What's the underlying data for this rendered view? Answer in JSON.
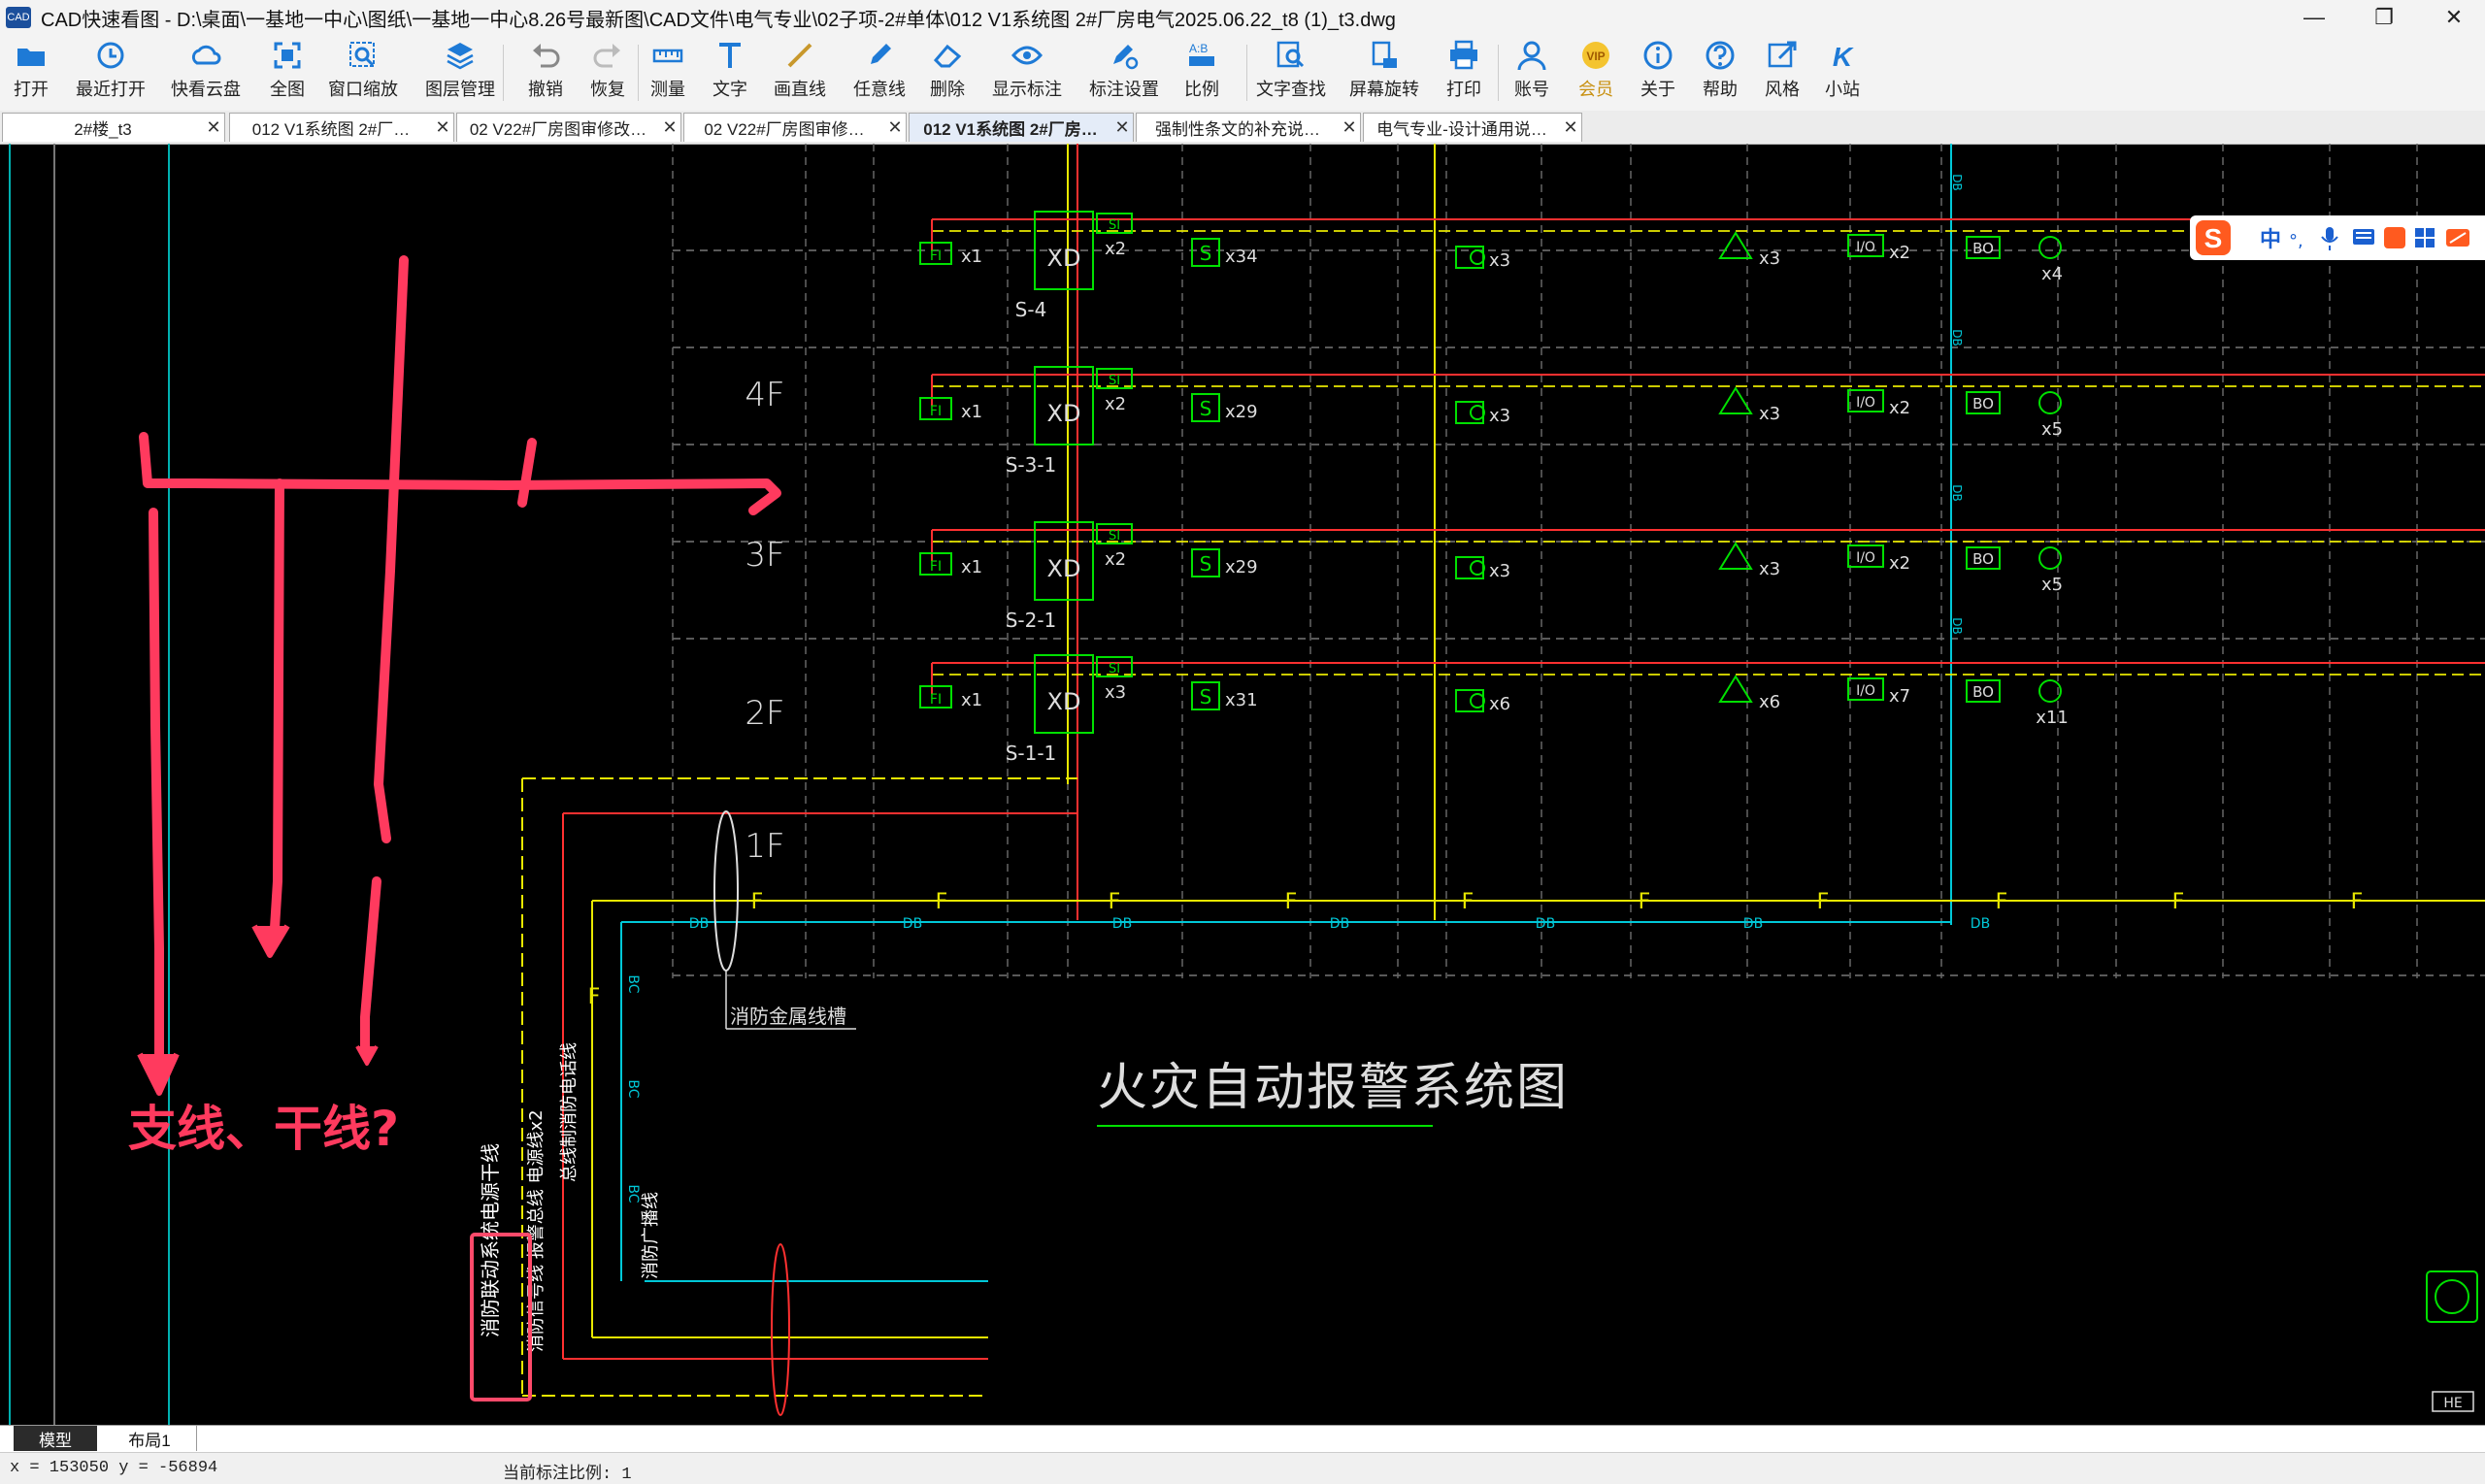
{
  "window": {
    "title": "CAD快速看图 - D:\\桌面\\一基地一中心\\图纸\\一基地一中心8.26号最新图\\CAD文件\\电气专业\\02子项-2#单体\\012 V1系统图 2#厂房电气2025.06.22_t8 (1)_t3.dwg",
    "app_icon_text": "CAD"
  },
  "toolbar": [
    {
      "label": "打开",
      "icon": "folder-icon"
    },
    {
      "label": "最近打开",
      "icon": "clock-icon"
    },
    {
      "label": "快看云盘",
      "icon": "cloud-icon"
    },
    {
      "label": "全图",
      "icon": "fullview-icon"
    },
    {
      "label": "窗口缩放",
      "icon": "zoom-window-icon"
    },
    {
      "label": "图层管理",
      "icon": "layers-icon"
    },
    {
      "label": "撤销",
      "icon": "undo-icon"
    },
    {
      "label": "恢复",
      "icon": "redo-icon"
    },
    {
      "label": "测量",
      "icon": "ruler-icon"
    },
    {
      "label": "文字",
      "icon": "text-icon"
    },
    {
      "label": "画直线",
      "icon": "line-icon"
    },
    {
      "label": "任意线",
      "icon": "pen-icon"
    },
    {
      "label": "删除",
      "icon": "eraser-icon"
    },
    {
      "label": "显示标注",
      "icon": "eye-icon"
    },
    {
      "label": "标注设置",
      "icon": "annotation-settings-icon"
    },
    {
      "label": "比例",
      "icon": "scale-icon"
    },
    {
      "label": "文字查找",
      "icon": "text-search-icon"
    },
    {
      "label": "屏幕旋转",
      "icon": "rotate-icon"
    },
    {
      "label": "打印",
      "icon": "printer-icon"
    },
    {
      "label": "账号",
      "icon": "user-icon"
    },
    {
      "label": "会员",
      "icon": "vip-icon",
      "badge": "VIP"
    },
    {
      "label": "关于",
      "icon": "info-icon"
    },
    {
      "label": "帮助",
      "icon": "help-icon"
    },
    {
      "label": "风格",
      "icon": "style-icon"
    },
    {
      "label": "小站",
      "icon": "station-icon"
    }
  ],
  "tabs": [
    {
      "label": "2#楼_t3",
      "active": false
    },
    {
      "label": "012 V1系统图 2#厂…",
      "active": false
    },
    {
      "label": "02 V22#厂房图审修改…",
      "active": false
    },
    {
      "label": "02 V22#厂房图审修…",
      "active": false
    },
    {
      "label": "012 V1系统图 2#厂房…",
      "active": true
    },
    {
      "label": "强制性条文的补充说…",
      "active": false
    },
    {
      "label": "电气专业-设计通用说…",
      "active": false
    }
  ],
  "drawing": {
    "floors": [
      "4F",
      "3F",
      "2F",
      "1F"
    ],
    "rows": [
      {
        "fi": "x1",
        "xd": "x2",
        "s": "x34",
        "cam": "x3",
        "bao": "x3",
        "io": "x2",
        "speaker": "x4",
        "module": "S-4"
      },
      {
        "fi": "x1",
        "xd": "x2",
        "s": "x29",
        "cam": "x3",
        "bao": "x3",
        "io": "x2",
        "speaker": "x5",
        "module": "S-3-1"
      },
      {
        "fi": "x1",
        "xd": "x2",
        "s": "x29",
        "cam": "x3",
        "bao": "x3",
        "io": "x2",
        "speaker": "x5",
        "module": "S-2-1"
      },
      {
        "fi": "x1",
        "xd": "x3",
        "s": "x31",
        "cam": "x6",
        "bao": "x6",
        "io": "x7",
        "speaker": "x11",
        "module": "S-1-1"
      }
    ],
    "symbols": {
      "fi": "FI",
      "xd": "XD",
      "si": "SI",
      "s": "S",
      "io": "I/O",
      "bo": "BO",
      "bus": "DB"
    },
    "bus_label": "F",
    "tray_label": "消防金属线槽",
    "diagram_title": "火灾自动报警系统图",
    "vertical_labels": {
      "v1": "消防联动系统电源干线",
      "v2": "消防信号线 报警总线 电源线x2",
      "v3": "总线制消防电话线",
      "v4": "消防广播线",
      "bc": "BC",
      "f": "F"
    },
    "annotation_question": "支线、干线?",
    "he_badge": "HE"
  },
  "bottom_tabs": [
    {
      "label": "模型",
      "active": true
    },
    {
      "label": "布局1",
      "active": false
    }
  ],
  "status": {
    "coords": "x = 153050 y = -56894",
    "scale": "当前标注比例: 1"
  },
  "ime": {
    "mode": "中",
    "punct": "°,"
  },
  "colors": {
    "red": "#ff3030",
    "green": "#00e000",
    "yellow": "#e8e800",
    "cyan": "#00c8d8",
    "annotation": "#ff3a5e"
  }
}
